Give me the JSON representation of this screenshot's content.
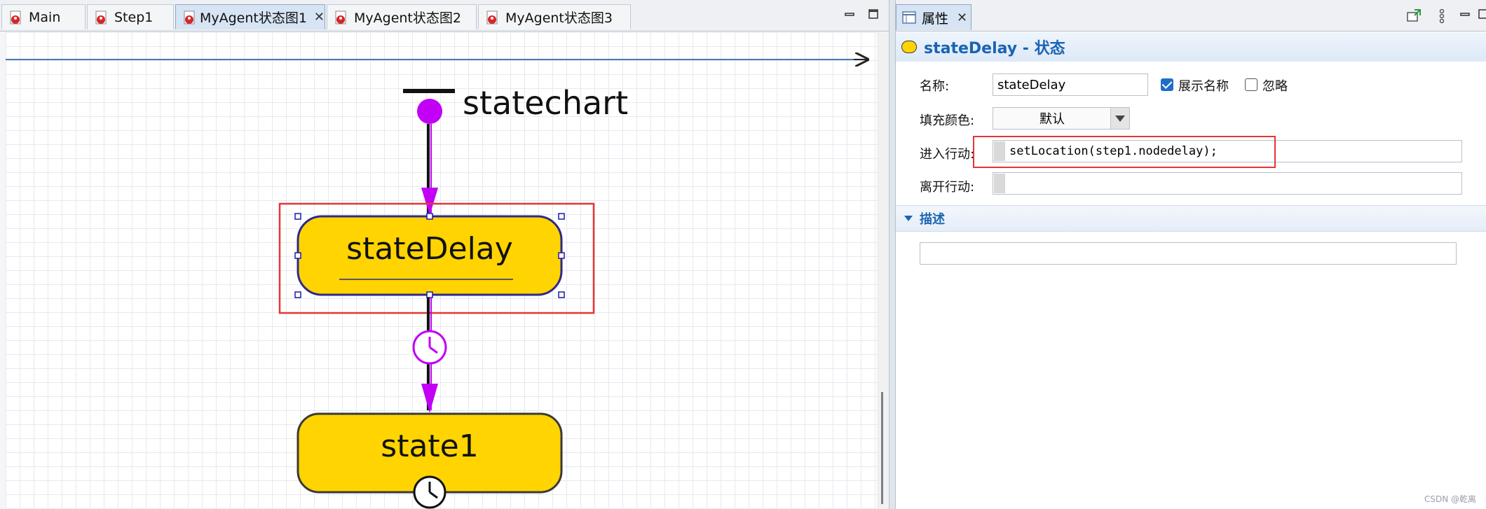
{
  "editor": {
    "tabs": [
      {
        "label": "Main",
        "active": false
      },
      {
        "label": "Step1",
        "active": false
      },
      {
        "label": "MyAgent状态图1",
        "active": true,
        "closable": true
      },
      {
        "label": "MyAgent状态图2",
        "active": false
      },
      {
        "label": "MyAgent状态图3",
        "active": false
      }
    ],
    "statechart_label": "statechart",
    "state_delay_label": "stateDelay",
    "state1_label": "state1",
    "colors": {
      "state_fill": "#ffd400",
      "transition": "#c100f5",
      "selection": "#e53535"
    }
  },
  "properties": {
    "tab_label": "属性",
    "title": "stateDelay - 状态",
    "name_label": "名称:",
    "name_value": "stateDelay",
    "show_name_label": "展示名称",
    "show_name_checked": true,
    "ignore_label": "忽略",
    "ignore_checked": false,
    "fill_color_label": "填充颜色:",
    "fill_color_value": "默认",
    "entry_action_label": "进入行动:",
    "entry_action_value": "setLocation(step1.nodedelay);",
    "exit_action_label": "离开行动:",
    "exit_action_value": "",
    "description_section": "描述",
    "description_value": ""
  },
  "watermark": "CSDN @乾离"
}
